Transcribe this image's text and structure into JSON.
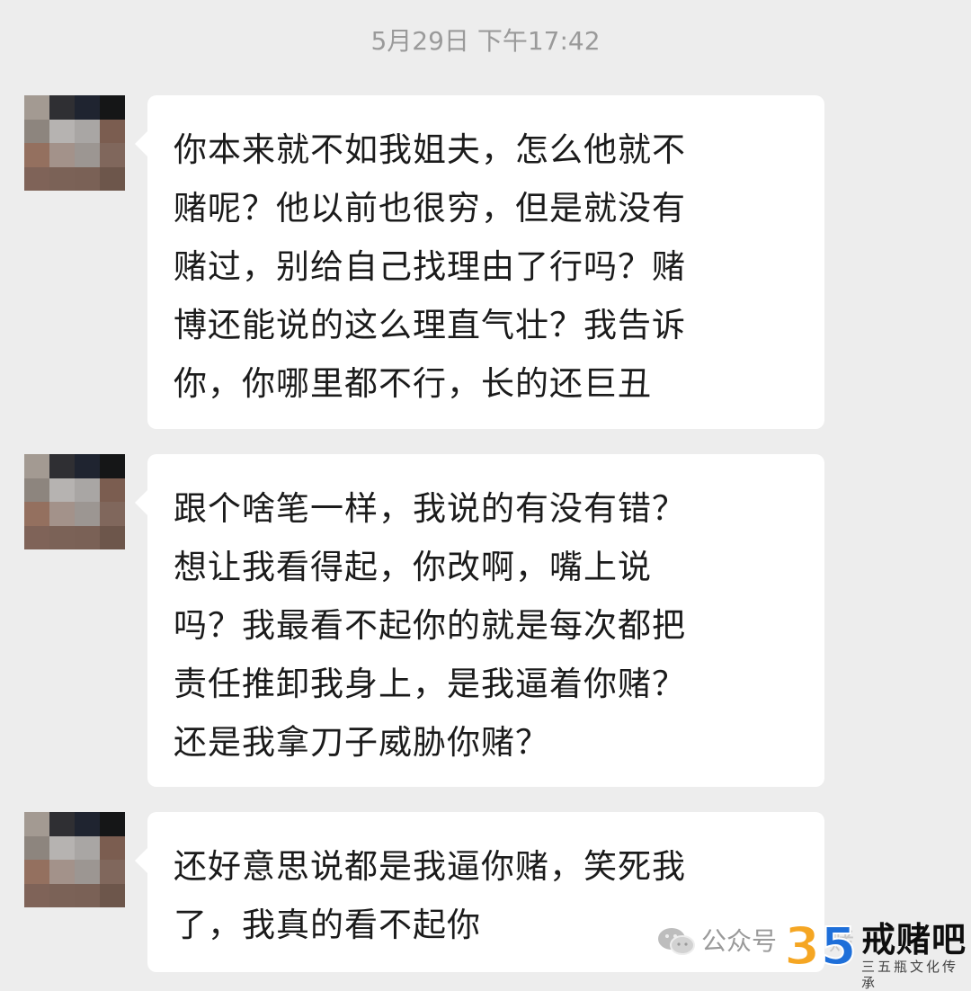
{
  "timestamp": "5月29日 下午17:42",
  "messages": [
    {
      "lines": [
        "你本来就不如我姐夫，怎么他就不",
        "赌呢？他以前也很穷，但是就没有",
        "赌过，别给自己找理由了行吗？赌",
        "博还能说的这么理直气壮？我告诉",
        "你，你哪里都不行，长的还巨丑"
      ]
    },
    {
      "lines": [
        "跟个啥笔一样，我说的有没有错？",
        "想让我看得起，你改啊，嘴上说",
        "吗？我最看不起你的就是每次都把",
        "责任推卸我身上，是我逼着你赌？",
        "还是我拿刀子威胁你赌？"
      ]
    },
    {
      "lines": [
        "还好意思说都是我逼你赌，笑死我",
        "了，我真的看不起你"
      ]
    }
  ],
  "avatar_colors": [
    "#a39a92",
    "#2f2f33",
    "#1f2430",
    "#151617",
    "#8d857e",
    "#b6b3b1",
    "#a9a6a4",
    "#7b5d50",
    "#94705f",
    "#a3928a",
    "#9c9692",
    "#80675c",
    "#7f6358",
    "#7b6257",
    "#7a6156",
    "#6d564b"
  ],
  "watermark": {
    "icon": "wechat-icon",
    "label": "公众号",
    "faded_text": "赌",
    "logo_number": "35",
    "brand": "戒赌吧",
    "subtitle": "三五瓶文化传承",
    "logo_colors": [
      "#f5a623",
      "#1e6fd9"
    ]
  }
}
